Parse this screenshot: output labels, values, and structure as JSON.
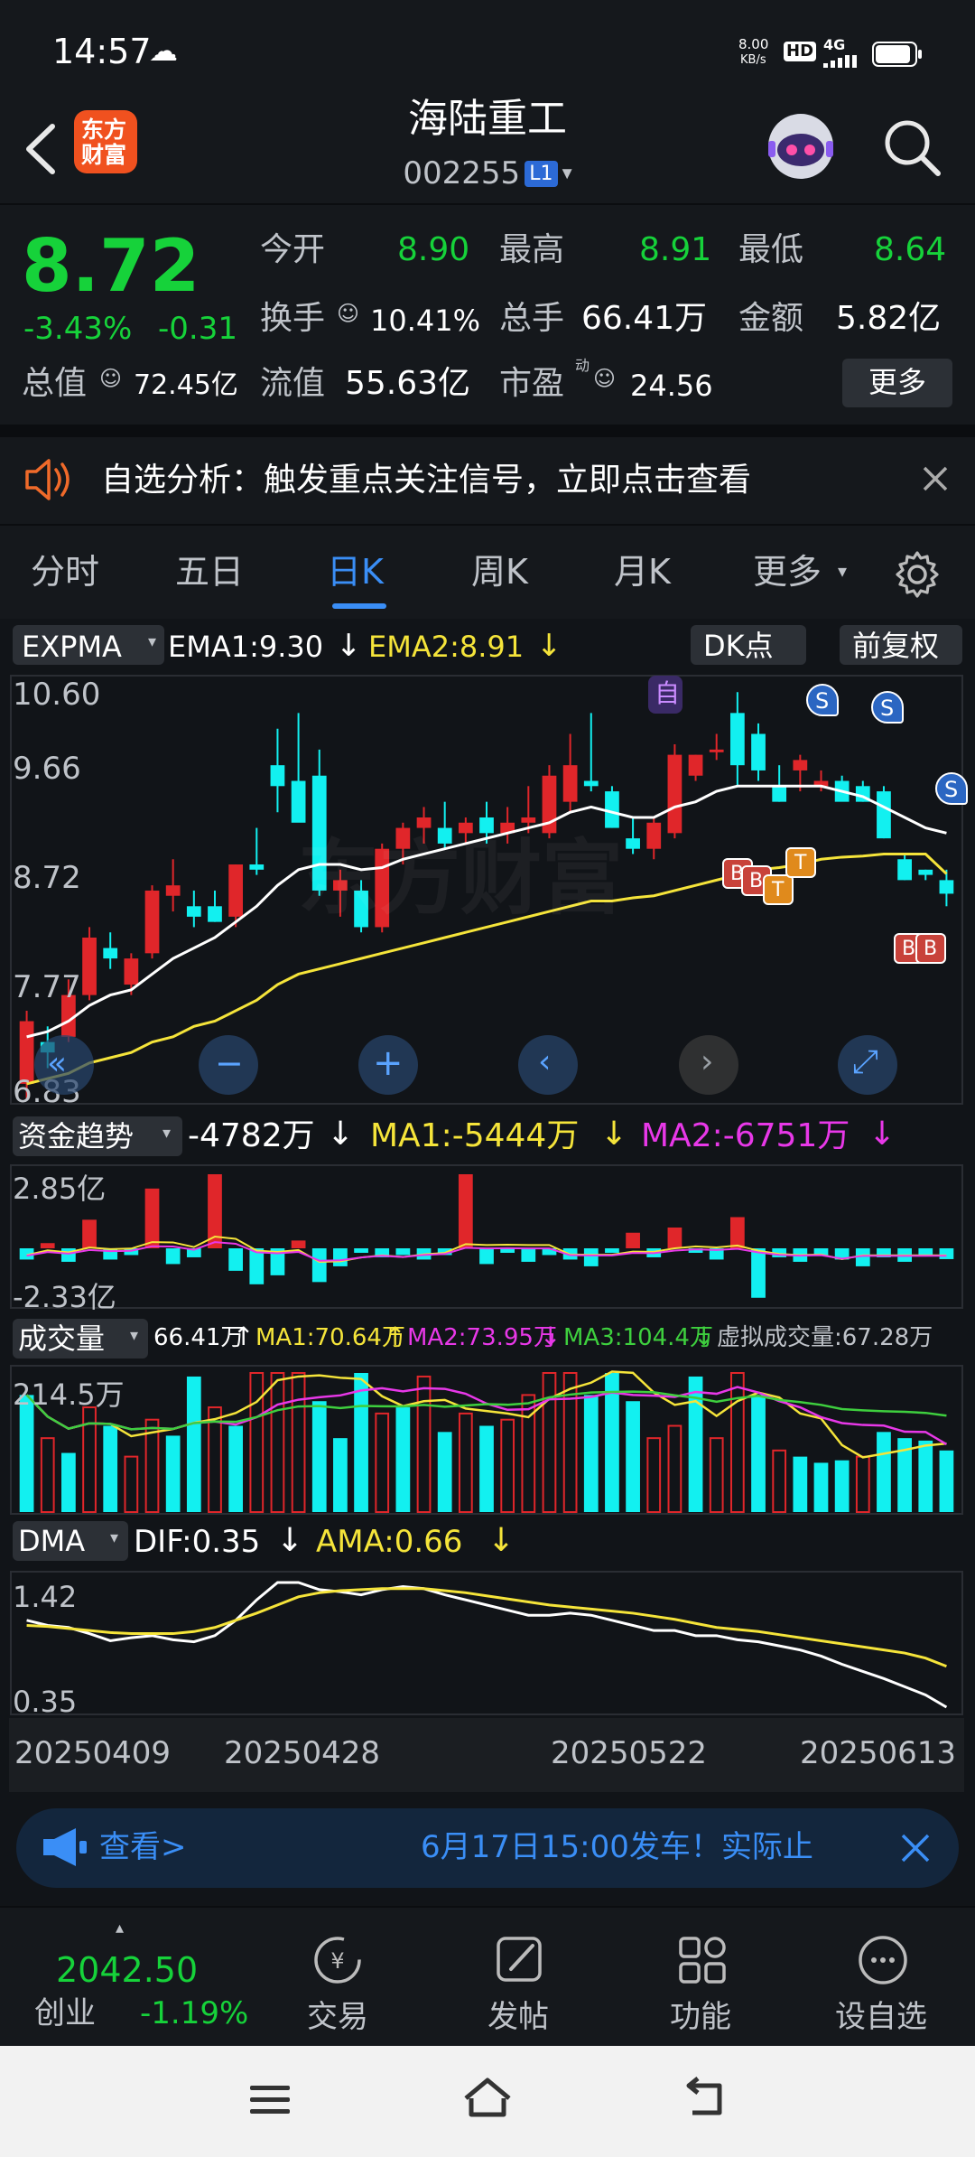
{
  "status_bar": {
    "time": "14:57",
    "net_speed_top": "8.00",
    "net_speed_bottom": "KB/s",
    "hd": "HD",
    "signal": "4G"
  },
  "header": {
    "logo_line1": "东方",
    "logo_line2": "财富",
    "stock_name": "海陆重工",
    "stock_code": "002255",
    "level_badge": "L1"
  },
  "quote": {
    "price": "8.72",
    "change_pct": "-3.43%",
    "change_abs": "-0.31",
    "open_label": "今开",
    "open_value": "8.90",
    "high_label": "最高",
    "high_value": "8.91",
    "low_label": "最低",
    "low_value": "8.64",
    "turnover_label": "换手",
    "turnover_value": "10.41%",
    "volume_label": "总手",
    "volume_value": "66.41万",
    "amount_label": "金额",
    "amount_value": "5.82亿",
    "mcap_label": "总值",
    "mcap_value": "72.45亿",
    "float_label": "流值",
    "float_value": "55.63亿",
    "pe_label": "市盈",
    "pe_sup": "动",
    "pe_value": "24.56",
    "more_button": "更多"
  },
  "banner": {
    "text": "自选分析：触发重点关注信号，立即点击查看"
  },
  "tabs": [
    {
      "label": "分时",
      "active": false
    },
    {
      "label": "五日",
      "active": false
    },
    {
      "label": "日K",
      "active": true
    },
    {
      "label": "周K",
      "active": false
    },
    {
      "label": "月K",
      "active": false
    },
    {
      "label": "更多",
      "active": false
    }
  ],
  "kline": {
    "indicator": "EXPMA",
    "ema1": "EMA1:9.30",
    "ema2": "EMA2:8.91",
    "dk_button": "DK点",
    "adjust_button": "前复权",
    "y_ticks": [
      "10.60",
      "9.66",
      "8.72",
      "7.77",
      "6.83"
    ],
    "watermark": "东方财富",
    "marker_zi": "自",
    "buy_marker": "B",
    "sell_marker": "S",
    "t_marker": "T"
  },
  "capital_flow": {
    "indicator": "资金趋势",
    "value": "-4782万",
    "ma1": "MA1:-5444万",
    "ma2": "MA2:-6751万",
    "y_top": "2.85亿",
    "y_bottom": "-2.33亿"
  },
  "volume": {
    "indicator": "成交量",
    "value": "66.41万",
    "ma1": "MA1:70.64万",
    "ma2": "MA2:73.95万",
    "ma3": "MA3:104.4万",
    "virtual": "虚拟成交量:67.28万",
    "y_top": "214.5万"
  },
  "dma": {
    "indicator": "DMA",
    "dif": "DIF:0.35",
    "ama": "AMA:0.66",
    "y_top": "1.42",
    "y_bottom": "0.35"
  },
  "dates": [
    "20250409",
    "20250428",
    "20250522",
    "20250613"
  ],
  "ticker": {
    "left_text": "查看>",
    "message": "6月17日15:00发车！实际止"
  },
  "bottom": {
    "index_value": "2042.50",
    "index_name": "创业",
    "index_change": "-1.19%",
    "trade": "交易",
    "post": "发帖",
    "func": "功能",
    "add": "设自选"
  },
  "colors": {
    "up": "#e0262a",
    "down": "#12f0f0",
    "ema1": "#ffffff",
    "ema2": "#f5e43a",
    "ma2": "#e838e8",
    "ma3": "#3ecf3e",
    "accent": "#3a8ef6",
    "green": "#16d23a"
  },
  "chart_data": {
    "type": "candlestick",
    "x_start": "20250409",
    "x_end": "20250613",
    "ylim": [
      6.83,
      10.6
    ],
    "candles": [
      {
        "o": 6.9,
        "h": 7.6,
        "l": 6.75,
        "c": 7.5
      },
      {
        "o": 7.3,
        "h": 7.45,
        "l": 7.05,
        "c": 7.2
      },
      {
        "o": 7.35,
        "h": 7.9,
        "l": 7.3,
        "c": 7.75
      },
      {
        "o": 7.75,
        "h": 8.4,
        "l": 7.7,
        "c": 8.3
      },
      {
        "o": 8.2,
        "h": 8.35,
        "l": 8.0,
        "c": 8.1
      },
      {
        "o": 7.85,
        "h": 8.15,
        "l": 7.75,
        "c": 8.1
      },
      {
        "o": 8.15,
        "h": 8.8,
        "l": 8.1,
        "c": 8.75
      },
      {
        "o": 8.7,
        "h": 9.05,
        "l": 8.55,
        "c": 8.8
      },
      {
        "o": 8.6,
        "h": 8.75,
        "l": 8.4,
        "c": 8.5
      },
      {
        "o": 8.6,
        "h": 8.75,
        "l": 8.45,
        "c": 8.45
      },
      {
        "o": 8.5,
        "h": 9.0,
        "l": 8.4,
        "c": 9.0
      },
      {
        "o": 9.0,
        "h": 9.35,
        "l": 8.9,
        "c": 8.95
      },
      {
        "o": 9.95,
        "h": 10.3,
        "l": 9.5,
        "c": 9.75
      },
      {
        "o": 9.8,
        "h": 10.45,
        "l": 9.7,
        "c": 9.4
      },
      {
        "o": 9.85,
        "h": 10.1,
        "l": 8.7,
        "c": 8.75
      },
      {
        "o": 8.75,
        "h": 8.95,
        "l": 8.5,
        "c": 8.85
      },
      {
        "o": 8.75,
        "h": 8.85,
        "l": 8.35,
        "c": 8.4
      },
      {
        "o": 8.4,
        "h": 9.2,
        "l": 8.35,
        "c": 9.15
      },
      {
        "o": 9.15,
        "h": 9.4,
        "l": 9.0,
        "c": 9.35
      },
      {
        "o": 9.35,
        "h": 9.55,
        "l": 9.2,
        "c": 9.45
      },
      {
        "o": 9.35,
        "h": 9.6,
        "l": 9.15,
        "c": 9.2
      },
      {
        "o": 9.3,
        "h": 9.45,
        "l": 9.2,
        "c": 9.4
      },
      {
        "o": 9.45,
        "h": 9.6,
        "l": 9.2,
        "c": 9.3
      },
      {
        "o": 9.3,
        "h": 9.55,
        "l": 9.2,
        "c": 9.4
      },
      {
        "o": 9.4,
        "h": 9.75,
        "l": 9.3,
        "c": 9.45
      },
      {
        "o": 9.3,
        "h": 9.95,
        "l": 9.25,
        "c": 9.85
      },
      {
        "o": 9.6,
        "h": 10.25,
        "l": 9.5,
        "c": 9.95
      },
      {
        "o": 9.8,
        "h": 10.45,
        "l": 9.7,
        "c": 9.75
      },
      {
        "o": 9.7,
        "h": 9.75,
        "l": 9.35,
        "c": 9.35
      },
      {
        "o": 9.25,
        "h": 9.45,
        "l": 9.1,
        "c": 9.15
      },
      {
        "o": 9.15,
        "h": 9.45,
        "l": 9.05,
        "c": 9.4
      },
      {
        "o": 9.3,
        "h": 10.15,
        "l": 9.25,
        "c": 10.05
      },
      {
        "o": 9.85,
        "h": 10.05,
        "l": 9.8,
        "c": 10.05
      },
      {
        "o": 10.1,
        "h": 10.25,
        "l": 10.0,
        "c": 10.1
      },
      {
        "o": 10.45,
        "h": 10.65,
        "l": 9.75,
        "c": 9.95
      },
      {
        "o": 10.25,
        "h": 10.35,
        "l": 9.8,
        "c": 9.9
      },
      {
        "o": 9.75,
        "h": 9.95,
        "l": 9.6,
        "c": 9.6
      },
      {
        "o": 9.9,
        "h": 10.05,
        "l": 9.7,
        "c": 10.0
      },
      {
        "o": 9.75,
        "h": 9.9,
        "l": 9.7,
        "c": 9.8
      },
      {
        "o": 9.8,
        "h": 9.85,
        "l": 9.65,
        "c": 9.6
      },
      {
        "o": 9.75,
        "h": 9.8,
        "l": 9.6,
        "c": 9.6
      },
      {
        "o": 9.7,
        "h": 9.75,
        "l": 9.25,
        "c": 9.25
      },
      {
        "o": 9.05,
        "h": 9.1,
        "l": 8.85,
        "c": 8.85
      },
      {
        "o": 8.95,
        "h": 8.95,
        "l": 8.85,
        "c": 8.9
      },
      {
        "o": 8.85,
        "h": 8.95,
        "l": 8.6,
        "c": 8.72
      }
    ],
    "ema1": [
      7.35,
      7.4,
      7.5,
      7.65,
      7.75,
      7.8,
      7.95,
      8.1,
      8.2,
      8.3,
      8.45,
      8.6,
      8.8,
      8.95,
      9.0,
      9.0,
      8.95,
      8.97,
      9.05,
      9.1,
      9.15,
      9.2,
      9.25,
      9.3,
      9.35,
      9.4,
      9.5,
      9.55,
      9.5,
      9.45,
      9.45,
      9.55,
      9.6,
      9.7,
      9.75,
      9.75,
      9.75,
      9.75,
      9.75,
      9.7,
      9.65,
      9.55,
      9.45,
      9.35,
      9.3
    ],
    "ema2": [
      6.9,
      6.95,
      7.0,
      7.1,
      7.15,
      7.2,
      7.3,
      7.35,
      7.45,
      7.5,
      7.6,
      7.7,
      7.85,
      7.95,
      8.0,
      8.05,
      8.1,
      8.15,
      8.2,
      8.25,
      8.3,
      8.35,
      8.4,
      8.45,
      8.5,
      8.55,
      8.6,
      8.65,
      8.65,
      8.68,
      8.7,
      8.75,
      8.8,
      8.85,
      8.9,
      8.95,
      8.97,
      9.0,
      9.05,
      9.07,
      9.08,
      9.1,
      9.1,
      9.1,
      8.91
    ],
    "capital_flow": [
      -0.5,
      0.2,
      -0.6,
      1.1,
      -0.5,
      -0.3,
      2.3,
      -0.7,
      -0.4,
      2.85,
      -1.0,
      -1.6,
      -1.2,
      0.3,
      -1.5,
      -0.8,
      -0.2,
      -0.4,
      -0.3,
      -0.5,
      -0.3,
      2.85,
      -0.7,
      -0.2,
      -0.6,
      -0.3,
      -0.5,
      -0.8,
      -0.2,
      0.6,
      -0.4,
      0.8,
      -0.2,
      -0.5,
      1.2,
      -2.2,
      -0.4,
      -0.6,
      -0.3,
      -0.5,
      -0.8,
      -0.4,
      -0.6,
      -0.3,
      -0.48
    ],
    "volume": [
      95,
      60,
      48,
      85,
      70,
      45,
      75,
      62,
      110,
      85,
      70,
      120,
      150,
      125,
      90,
      60,
      115,
      80,
      85,
      110,
      65,
      80,
      70,
      75,
      95,
      140,
      120,
      95,
      120,
      90,
      60,
      70,
      110,
      60,
      150,
      95,
      50,
      45,
      40,
      42,
      45,
      65,
      60,
      58,
      50
    ],
    "vol_up": [
      false,
      true,
      false,
      true,
      false,
      true,
      true,
      false,
      false,
      true,
      false,
      true,
      true,
      true,
      false,
      false,
      false,
      true,
      false,
      true,
      false,
      true,
      false,
      true,
      true,
      true,
      true,
      false,
      false,
      false,
      true,
      true,
      false,
      true,
      true,
      false,
      true,
      false,
      false,
      false,
      true,
      false,
      false,
      false,
      false
    ],
    "dif": [
      1.05,
      1.0,
      0.98,
      0.92,
      0.85,
      0.88,
      0.9,
      0.86,
      0.84,
      0.9,
      1.05,
      1.25,
      1.42,
      1.42,
      1.35,
      1.33,
      1.3,
      1.35,
      1.38,
      1.36,
      1.3,
      1.25,
      1.2,
      1.15,
      1.1,
      1.1,
      1.12,
      1.1,
      1.05,
      1.0,
      0.95,
      0.95,
      0.9,
      0.9,
      0.86,
      0.84,
      0.8,
      0.76,
      0.7,
      0.62,
      0.55,
      0.48,
      0.4,
      0.32,
      0.2
    ],
    "ama": [
      1.0,
      0.99,
      0.97,
      0.95,
      0.93,
      0.92,
      0.92,
      0.92,
      0.94,
      0.98,
      1.05,
      1.12,
      1.2,
      1.28,
      1.32,
      1.34,
      1.35,
      1.36,
      1.36,
      1.36,
      1.34,
      1.32,
      1.29,
      1.26,
      1.23,
      1.2,
      1.18,
      1.16,
      1.14,
      1.12,
      1.09,
      1.06,
      1.02,
      0.98,
      0.96,
      0.94,
      0.91,
      0.88,
      0.85,
      0.82,
      0.79,
      0.76,
      0.73,
      0.68,
      0.6
    ]
  }
}
